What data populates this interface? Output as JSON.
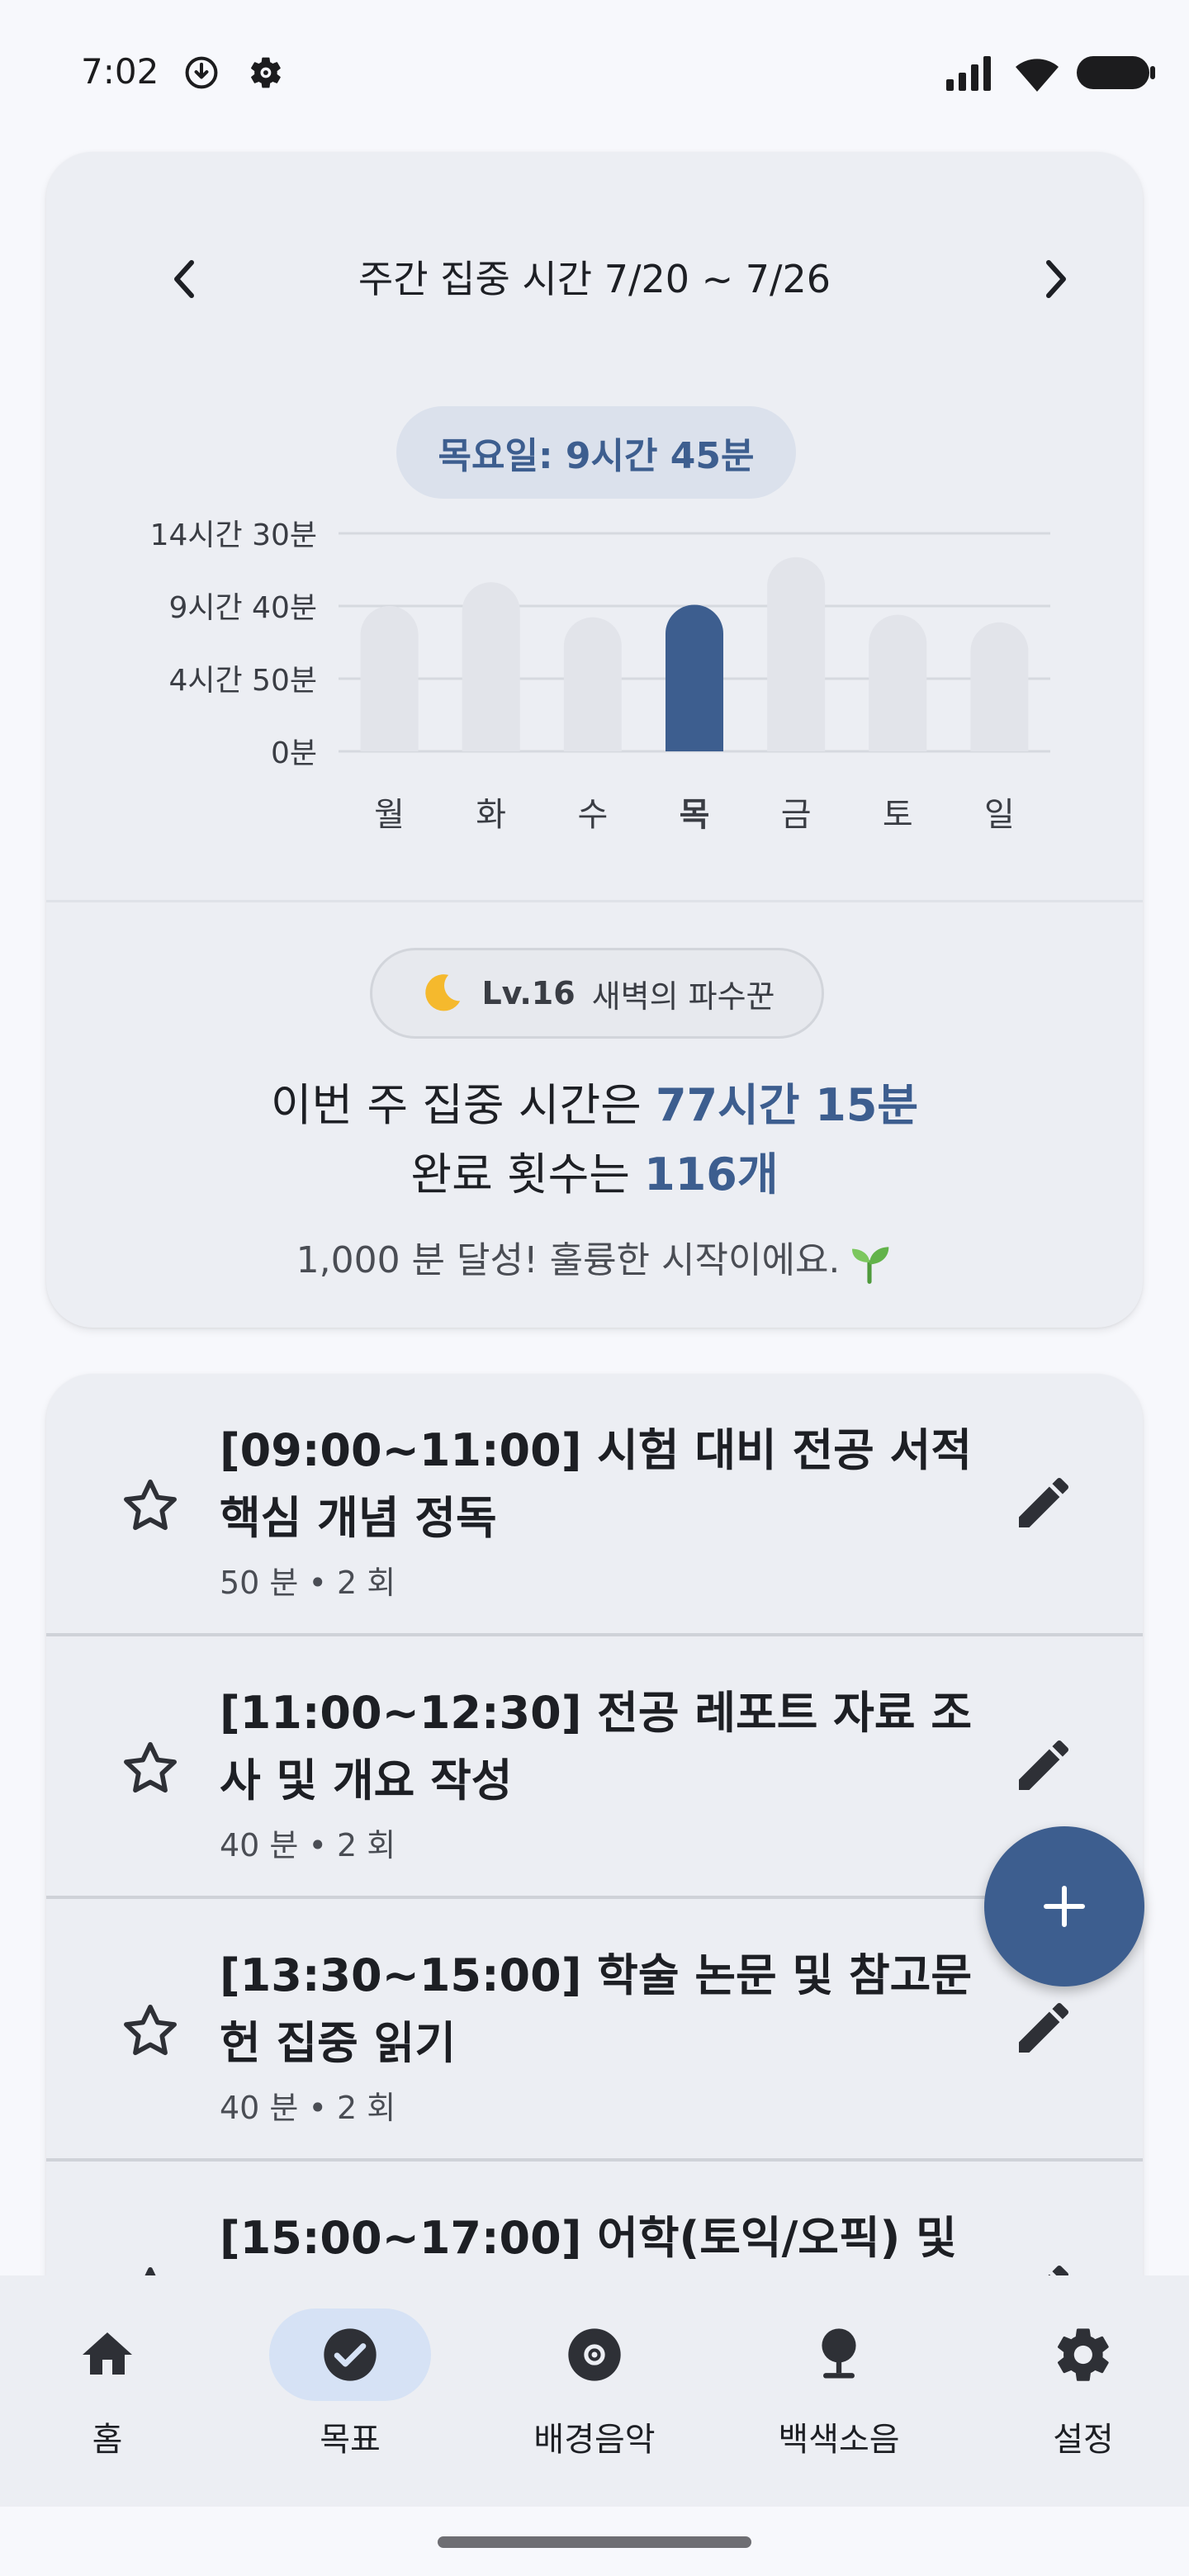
{
  "status_bar": {
    "time": "7:02"
  },
  "summary": {
    "week_title": "주간 집중 시간 7/20 ~ 7/26",
    "selected_day_label": "목요일: 9시간 45분",
    "level": {
      "emoji": "moon-icon",
      "lv": "Lv.16",
      "name": "새벽의 파수꾼"
    },
    "stat_line1_prefix": "이번 주 집중 시간은 ",
    "stat_line1_value": "77시간 15분",
    "stat_line2_prefix": "완료 횟수는 ",
    "stat_line2_value": "116개",
    "achievement": "1,000 분 달성! 훌륭한 시작이에요."
  },
  "chart_data": {
    "type": "bar",
    "categories": [
      "월",
      "화",
      "수",
      "목",
      "금",
      "토",
      "일"
    ],
    "values": [
      580,
      675,
      535,
      585,
      775,
      545,
      515
    ],
    "unit": "minutes",
    "yticks": [
      {
        "value": 0,
        "label": "0분"
      },
      {
        "value": 290,
        "label": "4시간 50분"
      },
      {
        "value": 580,
        "label": "9시간 40분"
      },
      {
        "value": 870,
        "label": "14시간 30분"
      }
    ],
    "ylim": [
      0,
      870
    ],
    "highlight_index": 3,
    "colors": {
      "bar": "#e2e4ea",
      "highlight": "#3d5e8f",
      "grid": "#d6d9df"
    },
    "grid": true
  },
  "goals": [
    {
      "title": "[09:00~11:00] 시험 대비 전공 서적 핵심 개념 정독",
      "meta": "50 분 • 2 회"
    },
    {
      "title": "[11:00~12:30] 전공 레포트 자료 조사 및 개요 작성",
      "meta": "40 분 • 2 회"
    },
    {
      "title": "[13:30~15:00] 학술 논문 및 참고문헌 집중 읽기",
      "meta": "40 분 • 2 회"
    },
    {
      "title": "[15:00~17:00] 어학(토익/오픽) 및",
      "meta": ""
    }
  ],
  "nav": {
    "items": [
      {
        "label": "홈",
        "icon": "home-icon"
      },
      {
        "label": "목표",
        "icon": "check-circle-icon"
      },
      {
        "label": "배경음악",
        "icon": "disc-icon"
      },
      {
        "label": "백색소음",
        "icon": "tree-icon"
      },
      {
        "label": "설정",
        "icon": "gear-icon"
      }
    ],
    "active_index": 1
  },
  "colors": {
    "accent": "#3d5e8f",
    "card": "#eceef3",
    "background": "#f7f8fc"
  }
}
